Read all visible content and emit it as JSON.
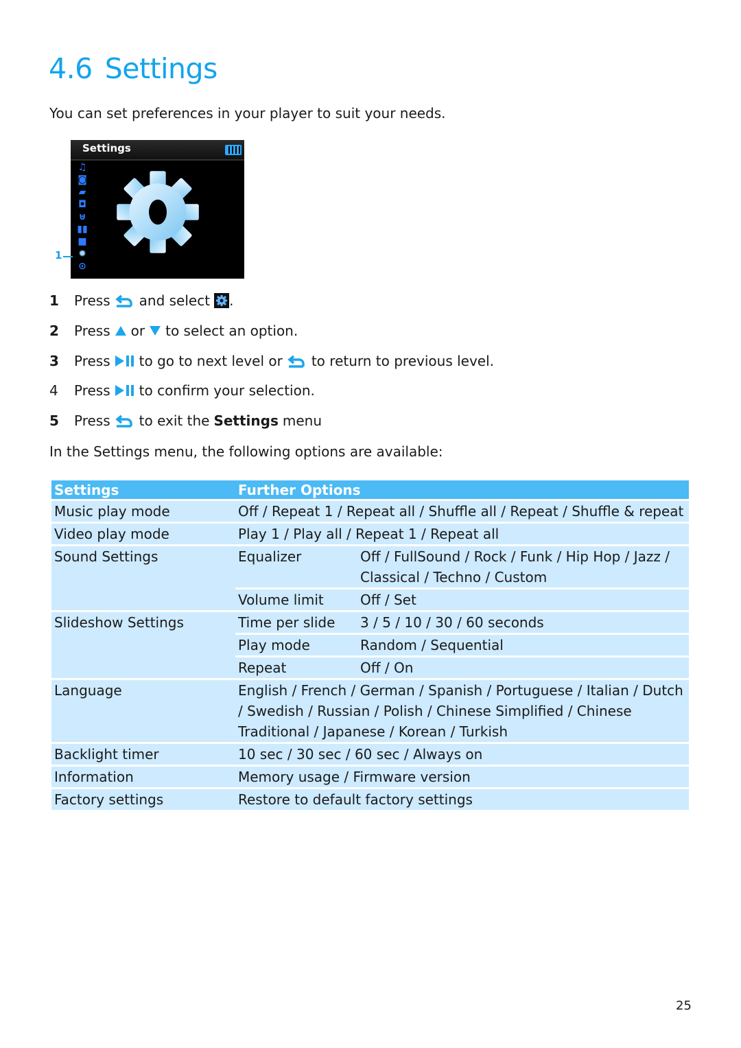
{
  "heading": {
    "number": "4.6",
    "title": "Settings"
  },
  "intro": "You can set preferences in your player to suit your needs.",
  "device_screen": {
    "title": "Settings",
    "menu_icons": [
      "music-icon",
      "camera-icon",
      "video-icon",
      "radio-icon",
      "microphone-icon",
      "book-icon",
      "folder-icon",
      "settings-icon",
      "play-circle-icon"
    ],
    "selected_icon": "settings-icon",
    "callout": "1"
  },
  "steps": [
    {
      "n": "1",
      "parts": [
        "Press",
        "and select",
        "."
      ]
    },
    {
      "n": "2",
      "parts": [
        "Press",
        "or",
        "to select an option."
      ]
    },
    {
      "n": "3",
      "parts": [
        "Press",
        "to go to next level or",
        "to return to previous level."
      ]
    },
    {
      "n": "4",
      "parts": [
        "Press",
        "to confirm your selection."
      ]
    },
    {
      "n": "5",
      "parts": [
        "Press",
        "to exit the",
        "Settings",
        "menu"
      ]
    }
  ],
  "table_intro": "In the Settings menu, the following options are available:",
  "table": {
    "headers": [
      "Settings",
      "Further Options"
    ],
    "rows": [
      {
        "setting": "Music play mode",
        "options": "Off / Repeat 1 / Repeat all / Shuffle all / Repeat / Shuffle & repeat"
      },
      {
        "setting": "Video play mode",
        "options": "Play 1 / Play all / Repeat 1 / Repeat all"
      },
      {
        "setting": "Sound Settings",
        "sub": [
          {
            "name": "Equalizer",
            "options": "Off / FullSound / Rock / Funk / Hip Hop / Jazz / Classical / Techno / Custom"
          },
          {
            "name": "Volume limit",
            "options": "Off / Set"
          }
        ]
      },
      {
        "setting": "Slideshow Settings",
        "sub": [
          {
            "name": "Time per slide",
            "options": "3 / 5 / 10 / 30 / 60 seconds"
          },
          {
            "name": "Play mode",
            "options": "Random / Sequential"
          },
          {
            "name": "Repeat",
            "options": "Off / On"
          }
        ]
      },
      {
        "setting": "Language",
        "options": "English / French / German / Spanish / Portuguese / Italian / Dutch / Swedish / Russian / Polish / Chinese Simplified / Chinese Traditional / Japanese / Korean / Turkish"
      },
      {
        "setting": "Backlight timer",
        "options": "10 sec / 30 sec / 60 sec / Always on"
      },
      {
        "setting": "Information",
        "options": "Memory usage / Firmware version"
      },
      {
        "setting": "Factory settings",
        "options": "Restore to default factory settings"
      }
    ]
  },
  "page_number": "25",
  "colors": {
    "accent": "#12a4ec",
    "header_bg": "#4bbaf5",
    "row_bg": "#cdeaff"
  }
}
